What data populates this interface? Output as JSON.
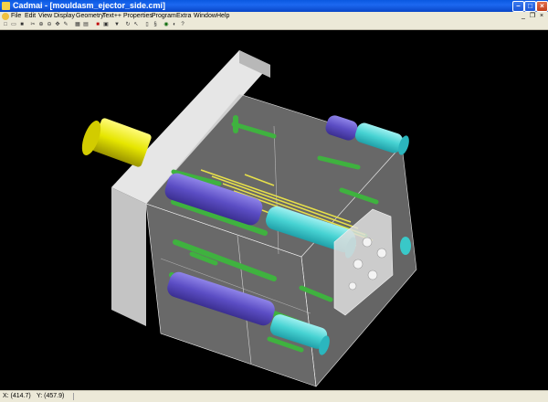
{
  "window": {
    "title": "Cadmai - [mouldasm_ejector_side.cmi]",
    "minimize_glyph": "–",
    "maximize_glyph": "□",
    "close_glyph": "×"
  },
  "menu": {
    "items": [
      {
        "label": "File"
      },
      {
        "label": "Edit"
      },
      {
        "label": "View"
      },
      {
        "label": "Display"
      },
      {
        "label": "Geometry"
      },
      {
        "label": "Text++"
      },
      {
        "label": "Properties"
      },
      {
        "label": "Program"
      },
      {
        "label": "Extra"
      },
      {
        "label": "Window"
      },
      {
        "label": "Help"
      }
    ],
    "mdi_minimize": "_",
    "mdi_restore": "❐",
    "mdi_close": "×"
  },
  "toolbar": {
    "tools": [
      {
        "icon": "new-file-icon",
        "glyph": "□"
      },
      {
        "icon": "open-folder-icon",
        "glyph": "▭"
      },
      {
        "icon": "save-icon",
        "glyph": "■"
      },
      {
        "icon": "cut-icon",
        "glyph": "✂"
      },
      {
        "icon": "zoom-in-icon",
        "glyph": "⊕"
      },
      {
        "icon": "zoom-out-icon",
        "glyph": "⊖"
      },
      {
        "icon": "pan-icon",
        "glyph": "✥"
      },
      {
        "icon": "pen-icon",
        "glyph": "✎"
      },
      {
        "icon": "grid-icon",
        "glyph": "▦"
      },
      {
        "icon": "layers-icon",
        "glyph": "▤"
      },
      {
        "icon": "stop-icon",
        "glyph": "■"
      },
      {
        "icon": "frame-icon",
        "glyph": "▣"
      },
      {
        "icon": "filter-icon",
        "glyph": "▼"
      },
      {
        "icon": "rotate-icon",
        "glyph": "↻"
      },
      {
        "icon": "cursor-icon",
        "glyph": "↖"
      },
      {
        "icon": "sheet-icon",
        "glyph": "▯"
      },
      {
        "icon": "script-icon",
        "glyph": "§"
      },
      {
        "icon": "render-icon",
        "glyph": "◉"
      },
      {
        "icon": "shade-icon",
        "glyph": "◐"
      },
      {
        "icon": "help-icon",
        "glyph": "?"
      }
    ]
  },
  "status": {
    "x": "X: (414.7)",
    "y": "Y: (457.9)"
  },
  "colors": {
    "plate": "#d8d8d8",
    "plate_shadow": "#a8a8a8",
    "glass": "#c8c8c8",
    "purple_pin": "#6a5acd",
    "cyan_pin": "#46d2d2",
    "green_pin": "#3fb23f",
    "yellow_pin": "#e8e14a",
    "nozzle": "#e6e600"
  }
}
